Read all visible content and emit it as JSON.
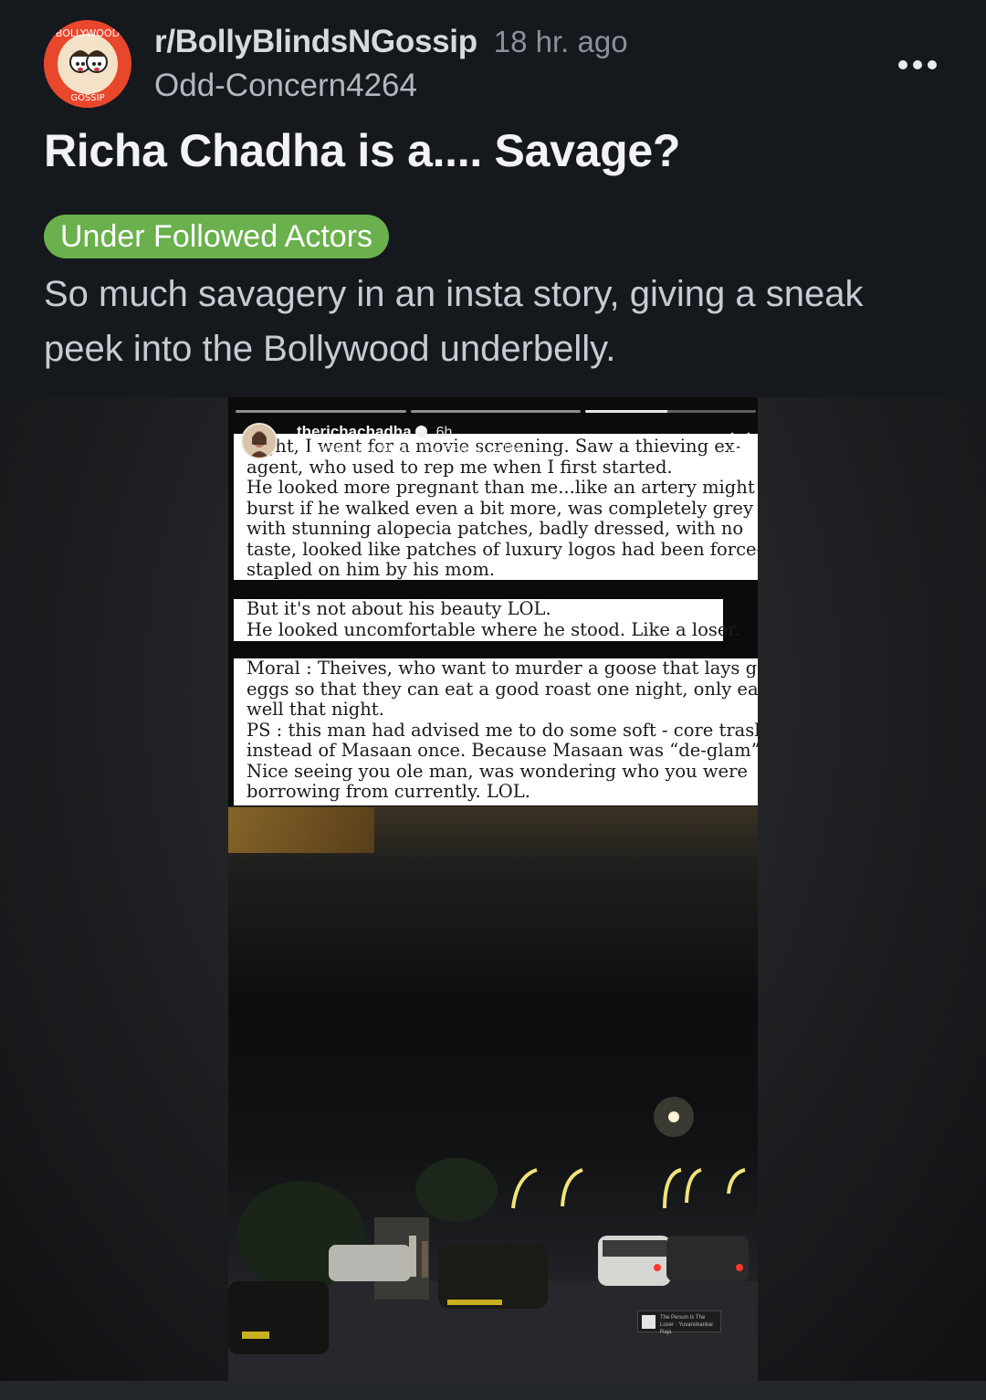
{
  "post": {
    "subreddit": "r/BollyBlindsNGossip",
    "age": "18 hr. ago",
    "author": "Odd-Concern4264",
    "title": "Richa Chadha is a.... Savage?",
    "flair": "Under Followed Actors",
    "flair_color": "#6ab04c",
    "body": "So much savagery in an insta story, giving a sneak peek into the Bollywood underbelly.",
    "avatar_text": {
      "top": "BOLLYWOOD",
      "bottom": "GOSSIP"
    },
    "avatar_color": "#e8472c"
  },
  "icons": {
    "more": "more-horizontal-icon",
    "close": "close-icon",
    "verified": "verified-badge-icon"
  },
  "story": {
    "handle": "therichachadha",
    "age": "6h",
    "music": "Yuvanshankar Raja · The Person Is The Lo...",
    "text_block_1": [
      "night, I went for a movie screening. Saw a thieving ex-",
      "agent, who used to rep me when I first started.",
      "He looked more pregnant than me...like an artery might",
      "burst if he walked even a bit more, was completely grey",
      "with stunning alopecia patches, badly dressed, with no",
      "taste, looked like patches of luxury logos had been force-",
      "stapled on him by his mom."
    ],
    "text_block_2": [
      "But it's not about his beauty LOL.",
      "He looked uncomfortable where he stood. Like a loser."
    ],
    "text_block_3": [
      "Moral : Theives, who want to murder a goose that lays gold",
      "eggs so that they can eat a good roast one night, only eat",
      "well that night.",
      "PS : this man had advised me to do some soft - core trash,",
      "instead of Masaan once. Because Masaan was “de-glam”.",
      "Nice seeing you ole man, was wondering who you were",
      "borrowing from currently. LOL."
    ],
    "watermark": "The Person Is The Loser · Yuvanshankar Raja"
  }
}
